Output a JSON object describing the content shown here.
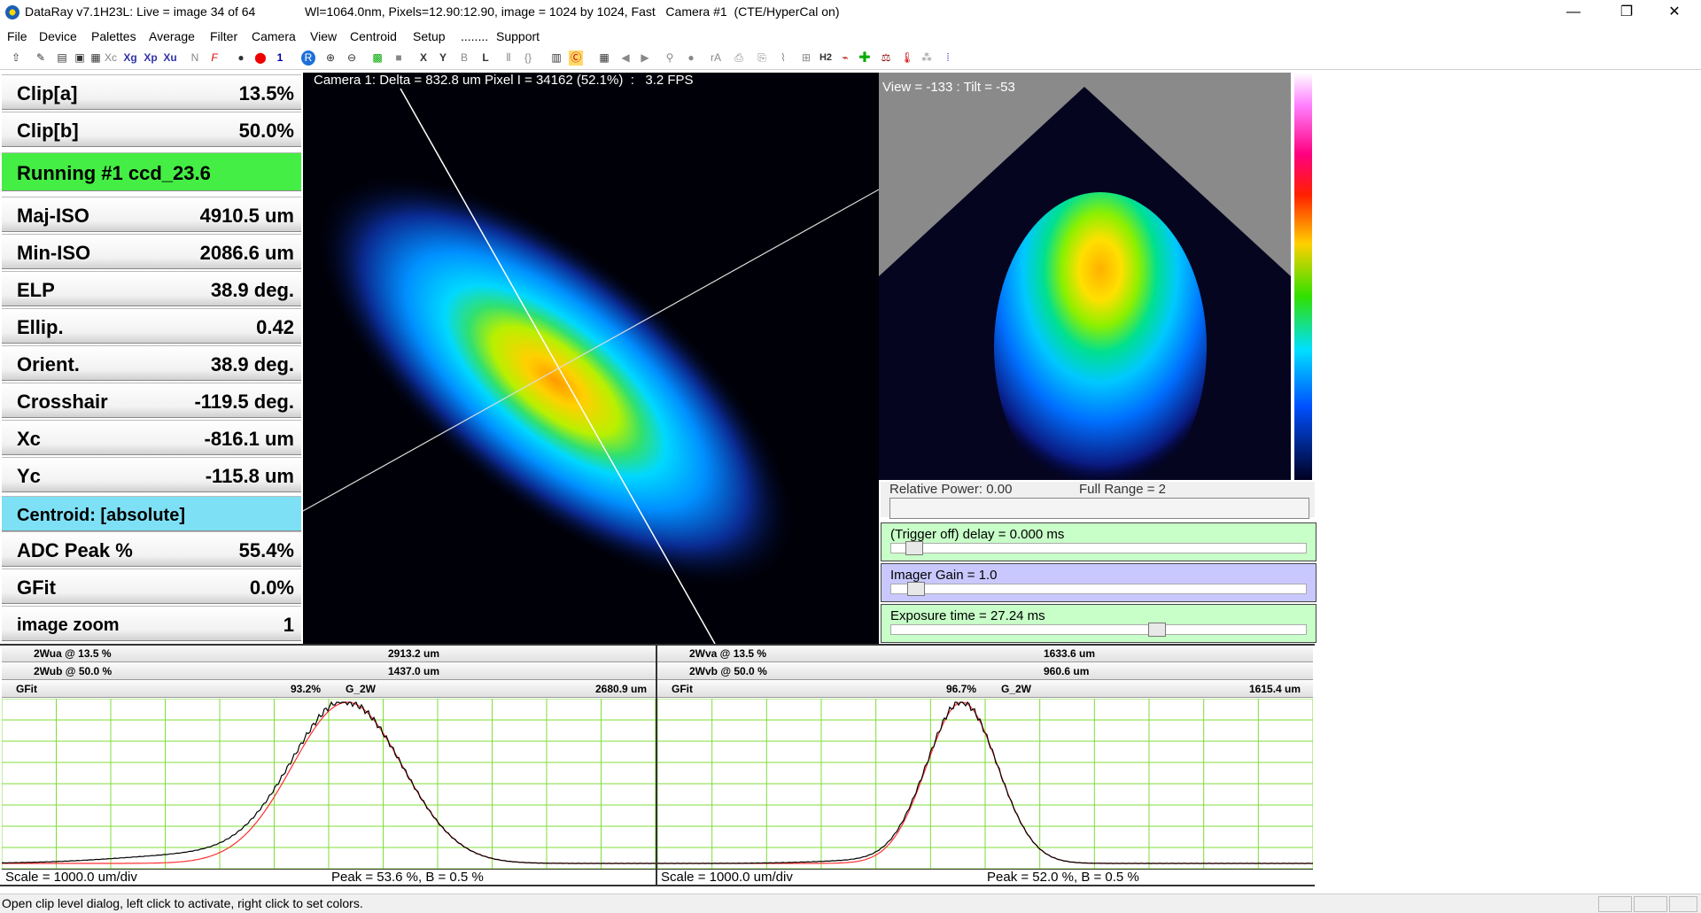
{
  "title": {
    "app": "DataRay v7.1H23L: Live = image 34 of 64",
    "info": "Wl=1064.0nm, Pixels=12.90:12.90, image = 1024 by 1024, Fast   Camera #1  (CTE/HyperCal on)",
    "min": "—",
    "max": "❐",
    "close": "✕"
  },
  "menu": [
    "File",
    "Device",
    "Palettes",
    "Average",
    "Filter",
    "Camera",
    "View",
    "Centroid",
    "Setup",
    "........",
    "Support"
  ],
  "toolbar": {
    "items": [
      "Xc",
      "Xg",
      "Xp",
      "Xu",
      "N",
      "F",
      "1",
      "R",
      "X",
      "Y",
      "B",
      "L",
      "rA",
      "H2"
    ]
  },
  "params": [
    {
      "label": "Clip[a]",
      "value": "13.5%"
    },
    {
      "label": "Clip[b]",
      "value": "50.0%"
    },
    {
      "label": "Running #1 ccd_23.6",
      "value": ""
    },
    {
      "label": "Maj-ISO",
      "value": "4910.5 um"
    },
    {
      "label": "Min-ISO",
      "value": "2086.6 um"
    },
    {
      "label": "ELP",
      "value": "38.9 deg."
    },
    {
      "label": "Ellip.",
      "value": "0.42"
    },
    {
      "label": "Orient.",
      "value": "38.9 deg."
    },
    {
      "label": "Crosshair",
      "value": "-119.5 deg."
    },
    {
      "label": "Xc",
      "value": "-816.1 um"
    },
    {
      "label": "Yc",
      "value": "-115.8 um"
    },
    {
      "label": "Centroid: [absolute]",
      "value": ""
    },
    {
      "label": "ADC Peak %",
      "value": "55.4%"
    },
    {
      "label": "GFit",
      "value": "0.0%"
    },
    {
      "label": "image zoom",
      "value": "1"
    }
  ],
  "beam2d": {
    "caption": "Camera 1: Delta = 832.8 um Pixel I = 34162 (52.1%)  :   3.2 FPS"
  },
  "beam3d": {
    "caption": "View = -133 : Tilt = -53"
  },
  "power": {
    "relative": "Relative Power: 0.00",
    "range": "Full Range = 2"
  },
  "controls": {
    "trigger": "(Trigger off) delay = 0.000 ms",
    "gain": "Imager Gain = 1.0",
    "exposure": "Exposure time = 27.24 ms"
  },
  "profile_left": {
    "w1_label": "2Wua @ 13.5 %",
    "w1_value": "2913.2 um",
    "w2_label": "2Wub @ 50.0 %",
    "w2_value": "1437.0 um",
    "gfit_label": "GFit",
    "gfit_value": "93.2%",
    "g2w_label": "G_2W",
    "g2w_value": "2680.9 um",
    "scale": "Scale = 1000.0 um/div",
    "peak": "Peak = 53.6 %,  B = 0.5 %"
  },
  "profile_right": {
    "w1_label": "2Wva @ 13.5 %",
    "w1_value": "1633.6 um",
    "w2_label": "2Wvb @ 50.0 %",
    "w2_value": "960.6 um",
    "gfit_label": "GFit",
    "gfit_value": "96.7%",
    "g2w_label": "G_2W",
    "g2w_value": "1615.4 um",
    "scale": "Scale = 1000.0 um/div",
    "peak": "Peak = 52.0 %,  B = 0.5 %"
  },
  "status": "Open clip level dialog, left click to activate, right click to set colors.",
  "colors": {
    "running_bg": "#44ee44",
    "centroid_bg": "#7ee0f5",
    "slider_green": "#c8ffc8",
    "slider_blue": "#c8c8ff",
    "grid": "#7fdc3a"
  }
}
